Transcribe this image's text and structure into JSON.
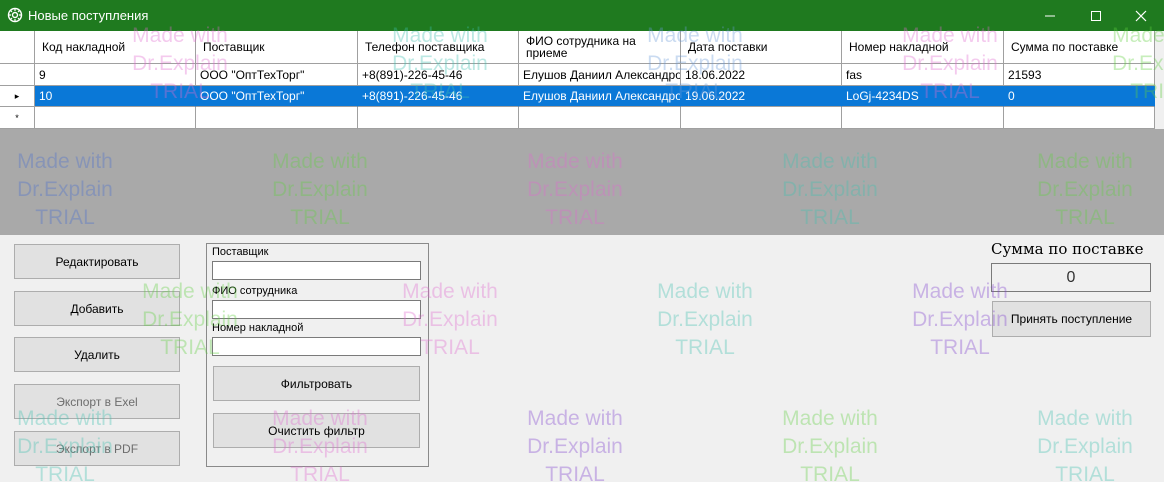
{
  "window": {
    "title": "Новые поступления",
    "app_icon": "gear-icon",
    "accent_color": "#1f7a1f",
    "min_icon": "minimize-icon",
    "max_icon": "maximize-icon",
    "close_icon": "close-icon"
  },
  "grid": {
    "columns": [
      "Код накладной",
      "Поставщик",
      "Телефон поставщика",
      "ФИО сотрудника на приеме",
      "Дата поставки",
      "Номер накладной",
      "Сумма по поставке"
    ],
    "rows": [
      [
        "9",
        "ООО \"ОптТехТорг\"",
        "+8(891)-226-45-46",
        "Елушов Даниил Александро...",
        "18.06.2022",
        "fas",
        "21593"
      ],
      [
        "10",
        "ООО \"ОптТехТорг\"",
        "+8(891)-226-45-46",
        "Елушов Даниил Александро...",
        "19.06.2022",
        "LoGj-4234DS",
        "0"
      ]
    ],
    "selected_row_color": "#0a78d7",
    "current_row_marker": "▸",
    "new_row_marker": "*"
  },
  "actions": {
    "edit": "Редактировать",
    "add": "Добавить",
    "delete": "Удалить",
    "export_excel": "Экспорт в Exel",
    "export_pdf": "Экспорт в PDF"
  },
  "filter": {
    "supplier_label": "Поставщик",
    "supplier_value": "",
    "employee_label": "ФИО сотрудника",
    "employee_value": "",
    "invoice_label": "Номер накладной",
    "invoice_value": "",
    "filter_button": "Фильтровать",
    "clear_button": "Очистить фильтр"
  },
  "summary": {
    "label": "Сумма по поставке",
    "value": "0",
    "accept_button": "Принять поступление"
  },
  "watermark": {
    "line1": "Made with",
    "line2": "Dr.Explain",
    "line3": "TRIAL"
  }
}
